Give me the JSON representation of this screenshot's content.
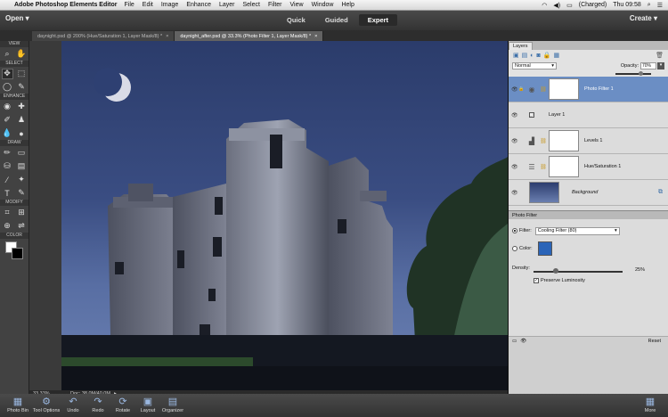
{
  "menubar": {
    "app_name": "Adobe Photoshop Elements Editor",
    "items": [
      "File",
      "Edit",
      "Image",
      "Enhance",
      "Layer",
      "Select",
      "Filter",
      "View",
      "Window",
      "Help"
    ],
    "battery": "(Charged)",
    "clock": "Thu 09:58"
  },
  "topbar": {
    "open_label": "Open",
    "create_label": "Create",
    "modes": [
      "Quick",
      "Guided",
      "Expert"
    ],
    "active_mode": "Expert"
  },
  "tabs": [
    {
      "label": "daynight.psd @ 200% (Hue/Saturation 1, Layer Mask/8) *"
    },
    {
      "label": "daynight_after.psd @ 33.3% (Photo Filter 1, Layer Mask/8) *"
    }
  ],
  "toolbar": {
    "sections": [
      "VIEW",
      "SELECT",
      "ENHANCE",
      "DRAW",
      "MODIFY",
      "COLOR"
    ]
  },
  "status": {
    "zoom": "33.33%",
    "doc": "Doc: 38.0M/40.0M"
  },
  "layers_panel": {
    "tab": "Layers",
    "blend_mode": "Normal",
    "opacity_label": "Opacity:",
    "opacity_value": "70%",
    "opacity_fraction": 0.7,
    "layers": [
      {
        "name": "Photo Filter 1",
        "active": true
      },
      {
        "name": "Layer 1",
        "active": false
      },
      {
        "name": "Levels 1",
        "active": false
      },
      {
        "name": "Hue/Saturation 1",
        "active": false
      },
      {
        "name": "Background",
        "active": false
      }
    ]
  },
  "photo_filter": {
    "tab": "Photo Filter",
    "filter_label": "Filter:",
    "filter_value": "Cooling Filter (80)",
    "color_label": "Color:",
    "color_hex": "#2a64b8",
    "density_label": "Density:",
    "density_value": "25%",
    "density_fraction": 0.25,
    "preserve_label": "Preserve Luminosity",
    "reset_label": "Reset"
  },
  "dock": [
    "Photo Bin",
    "Tool Options",
    "Undo",
    "Redo",
    "Rotate",
    "Layout",
    "Organizer",
    "More"
  ]
}
